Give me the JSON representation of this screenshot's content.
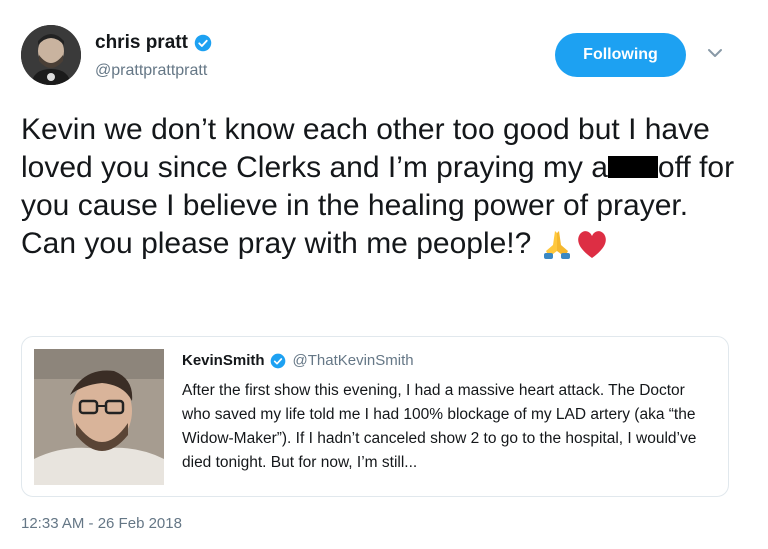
{
  "author": {
    "name": "chris pratt",
    "handle": "@prattprattpratt",
    "avatar": "profile-photo"
  },
  "follow_button": {
    "label": "Following",
    "color": "#1da1f2"
  },
  "menu_icon": "chevron-down-icon",
  "tweet": {
    "text_before_redaction": "Kevin we don’t know each other too good but I have loved you since Clerks and I’m praying my a",
    "text_after_redaction": "off for you cause I believe in the healing power of prayer. Can you please pray with me people!?",
    "emojis": [
      "folded-hands-icon",
      "red-heart-icon"
    ]
  },
  "quoted_tweet": {
    "name": "KevinSmith",
    "handle": "@ThatKevinSmith",
    "text": "After the first show this evening, I had a massive heart attack. The Doctor who saved my life told me I had 100% blockage of my LAD artery (aka “the Widow-Maker”). If I hadn’t canceled show 2 to go to the hospital, I would’ve died tonight. But for now, I’m still..."
  },
  "timestamp": "12:33 AM - 26 Feb 2018",
  "colors": {
    "text": "#14171a",
    "muted": "#657786",
    "accent": "#1da1f2",
    "border": "#e1e8ed"
  }
}
